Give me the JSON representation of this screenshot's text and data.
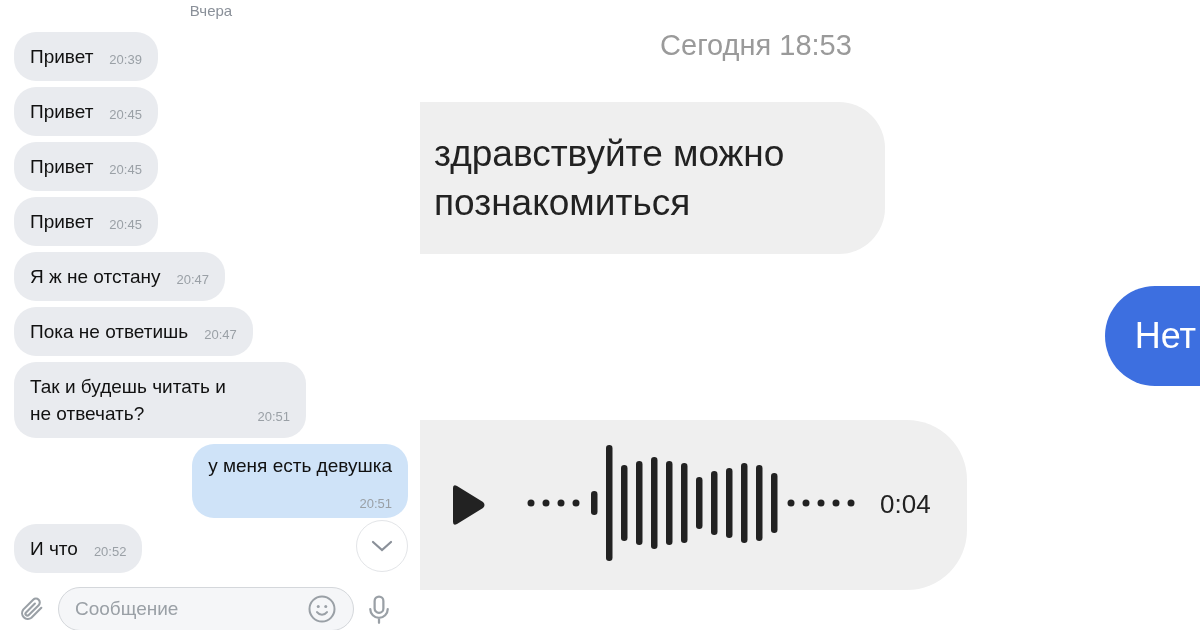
{
  "left_chat": {
    "date_divider": "Вчера",
    "messages": [
      {
        "kind": "incoming",
        "text": "Привет",
        "time": "20:39"
      },
      {
        "kind": "incoming",
        "text": "Привет",
        "time": "20:45"
      },
      {
        "kind": "incoming",
        "text": "Привет",
        "time": "20:45"
      },
      {
        "kind": "incoming",
        "text": "Привет",
        "time": "20:45"
      },
      {
        "kind": "incoming",
        "text": "Я ж не отстану",
        "time": "20:47"
      },
      {
        "kind": "incoming",
        "text": "Пока не ответишь",
        "time": "20:47"
      },
      {
        "kind": "incoming",
        "text": "Так и будешь читать и не отвечать?",
        "time": "20:51"
      },
      {
        "kind": "outgoing",
        "text": "у меня есть девушка",
        "time": "20:51"
      },
      {
        "kind": "incoming",
        "text": "И что",
        "time": "20:52"
      }
    ],
    "composer": {
      "placeholder": "Сообщение"
    }
  },
  "right_chat": {
    "date_divider": "Сегодня 18:53",
    "messages": [
      {
        "kind": "incoming",
        "text": "здравствуйте можно познакомиться"
      },
      {
        "kind": "outgoing",
        "text": "Нет"
      },
      {
        "kind": "voice",
        "duration": "0:04"
      }
    ]
  }
}
